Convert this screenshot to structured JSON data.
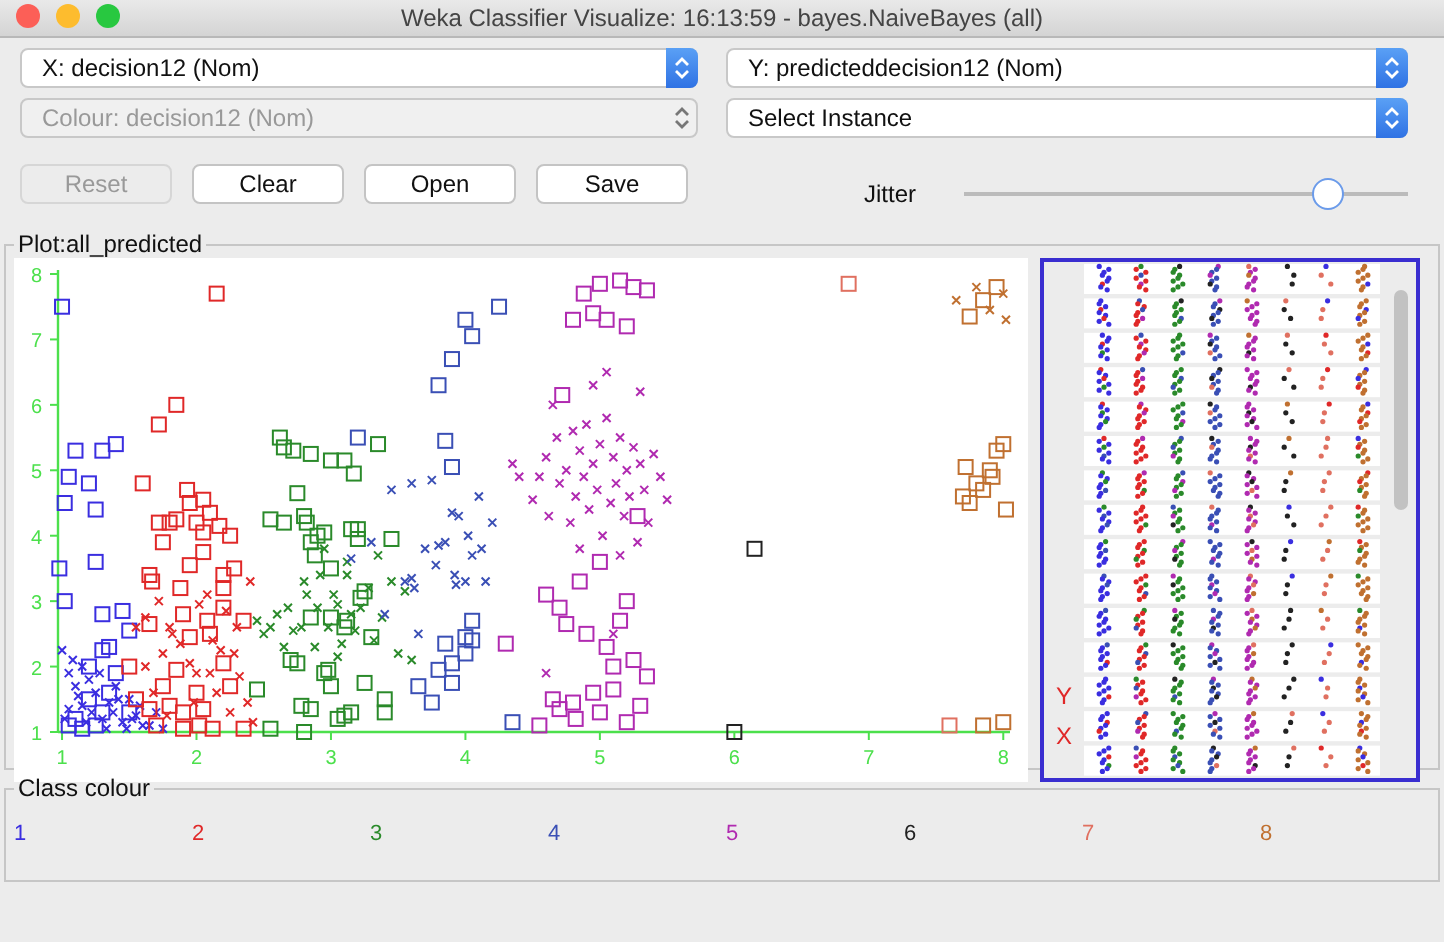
{
  "window": {
    "title": "Weka Classifier Visualize: 16:13:59 - bayes.NaiveBayes (all)"
  },
  "selectors": [
    {
      "label": "X: decision12 (Nom)",
      "disabled": false
    },
    {
      "label": "Y: predicteddecision12 (Nom)",
      "disabled": false
    },
    {
      "label": "Colour: decision12 (Nom)",
      "disabled": true
    },
    {
      "label": "Select Instance",
      "disabled": false
    }
  ],
  "buttons": [
    {
      "label": "Reset",
      "disabled": true
    },
    {
      "label": "Clear",
      "disabled": false
    },
    {
      "label": "Open",
      "disabled": false
    },
    {
      "label": "Save",
      "disabled": false
    }
  ],
  "jitter": {
    "label": "Jitter",
    "level": 0.82
  },
  "plot": {
    "title": "Plot:all_predicted",
    "chart_data": {
      "type": "scatter",
      "xlim": [
        0.97,
        8.05
      ],
      "ylim": [
        1,
        8
      ],
      "xticks": [
        1,
        2,
        3,
        4,
        5,
        6,
        7,
        8
      ],
      "yticks": [
        1,
        2,
        3,
        4,
        5,
        6,
        7,
        8
      ],
      "series": [
        {
          "color": "#3a2ee0",
          "marker": "square",
          "x": [
            1,
            1.1,
            1.05,
            1.2,
            1.3,
            1.4,
            1.02,
            1.25,
            1.25,
            0.98,
            1.02,
            1.45,
            1.3,
            1.35,
            1.3,
            1.5,
            1.2,
            1.4,
            1.1,
            1.2,
            1.05,
            1.3,
            1.15,
            1.35,
            1.25,
            1.5
          ],
          "values": [
            7.5,
            5.3,
            4.9,
            4.8,
            5.3,
            5.4,
            4.5,
            4.4,
            3.6,
            3.5,
            3,
            2.85,
            2.8,
            2.3,
            2.25,
            2.55,
            2,
            1.9,
            1.2,
            1.5,
            1.1,
            1.3,
            1.05,
            1.6,
            1.1,
            1.3
          ]
        },
        {
          "color": "#3a2ee0",
          "marker": "cross",
          "x": [
            1,
            1.05,
            1.1,
            1.15,
            1.2,
            1.25,
            1.3,
            1.35,
            1.4,
            1.45,
            1.5,
            1.55,
            1.6,
            1.05,
            1.12,
            1.18,
            1.22,
            1.28,
            1.33,
            1.38,
            1.42,
            1.48,
            1.52,
            1.58,
            1.65,
            1.7,
            1.75,
            1.02,
            1.08,
            1.15
          ],
          "values": [
            2.25,
            1.9,
            1.7,
            1.4,
            1.8,
            1.6,
            1.2,
            1.45,
            1.7,
            1.15,
            1.5,
            1.25,
            1.1,
            1.35,
            1.55,
            1.15,
            1.3,
            1.9,
            1.05,
            1.3,
            1.5,
            1.05,
            1.2,
            1.4,
            1.1,
            1.3,
            1.05,
            1.2,
            2.1,
            2
          ]
        },
        {
          "color": "#e02828",
          "marker": "square",
          "x": [
            2.15,
            1.85,
            1.72,
            1.6,
            1.72,
            1.8,
            1.85,
            1.95,
            1.93,
            2.05,
            2.1,
            2.0,
            2.05,
            2.17,
            2.25,
            1.75,
            1.95,
            2.05,
            2.2,
            1.65,
            1.67,
            1.88,
            2.28,
            2.2,
            1.9,
            2.08,
            2.2,
            1.65,
            2.35,
            1.5,
            1.95,
            2.1,
            2.2,
            2.25,
            1.75,
            1.85,
            2,
            1.55,
            1.65,
            1.8,
            1.9,
            2.05,
            1.7,
            1.9,
            2.02,
            2.12,
            2.35
          ],
          "values": [
            7.7,
            6,
            5.7,
            4.8,
            4.2,
            4.2,
            4.25,
            4.5,
            4.7,
            4.55,
            4.35,
            4.2,
            4.05,
            4.15,
            4.0,
            3.9,
            3.55,
            3.75,
            3.4,
            3.4,
            3.3,
            3.2,
            3.5,
            3.2,
            2.8,
            2.7,
            2.9,
            2.65,
            2.7,
            2,
            2.45,
            2.5,
            2.05,
            1.7,
            1.7,
            1.95,
            1.6,
            1.5,
            1.35,
            1.4,
            1.3,
            1.35,
            1.1,
            1.05,
            1.1,
            1.05,
            1.05
          ]
        },
        {
          "color": "#e02828",
          "marker": "cross",
          "x": [
            1.55,
            1.62,
            1.75,
            1.8,
            1.88,
            1.95,
            2.02,
            2.08,
            2.12,
            2.18,
            2.22,
            2.28,
            2.32,
            2.38,
            2.4,
            1.72,
            1.82,
            2.0,
            2.15,
            2.25,
            1.62,
            1.68,
            1.78,
            1.98,
            2.1,
            2.42,
            2.3
          ],
          "values": [
            2.6,
            2.75,
            2.2,
            2.6,
            2.35,
            2.05,
            2.95,
            3.1,
            2.4,
            2.25,
            2.85,
            2.2,
            1.85,
            1.45,
            3.3,
            3.0,
            2.5,
            1.9,
            1.6,
            1.3,
            2.0,
            1.6,
            1.25,
            1.45,
            1.9,
            1.15,
            2.6
          ]
        },
        {
          "color": "#2a8a2a",
          "marker": "square",
          "x": [
            2.62,
            2.65,
            2.72,
            2.85,
            3,
            3.1,
            3.17,
            3.35,
            2.75,
            2.55,
            2.65,
            2.8,
            2.82,
            2.9,
            2.95,
            3.15,
            3.2,
            3.2,
            3.45,
            2.85,
            2.88,
            3.0,
            3.25,
            3.22,
            3.0,
            3.1,
            3.12,
            2.85,
            2.98,
            2.95,
            3.3,
            2.7,
            2.75,
            2.45,
            2.78,
            2.85,
            3.0,
            3.25,
            3.4,
            3.4,
            3.1,
            3.05,
            3.15,
            2.55,
            2.8
          ],
          "values": [
            5.5,
            5.35,
            5.3,
            5.25,
            5.15,
            5.15,
            4.95,
            5.4,
            4.65,
            4.25,
            4.2,
            4.3,
            4.2,
            4.0,
            4.05,
            4.1,
            4.1,
            3.95,
            3.95,
            3.9,
            3.7,
            3.5,
            3.15,
            3.05,
            2.75,
            2.6,
            2.7,
            2.75,
            1.95,
            1.9,
            2.45,
            2.1,
            2.05,
            1.65,
            1.4,
            1.35,
            1.7,
            1.75,
            1.5,
            1.3,
            1.25,
            1.2,
            1.3,
            1.05,
            1.0
          ]
        },
        {
          "color": "#2a8a2a",
          "marker": "cross",
          "x": [
            2.45,
            2.55,
            2.6,
            2.68,
            2.72,
            2.8,
            2.82,
            2.9,
            2.92,
            2.98,
            3.02,
            3.05,
            3.08,
            3.12,
            3.15,
            3.18,
            3.22,
            3.28,
            3.32,
            3.38,
            3.45,
            3.5,
            3.55,
            3.6,
            2.88,
            2.78,
            2.65,
            3.12,
            3.35,
            2.95,
            3.05,
            2.5
          ],
          "values": [
            2.7,
            2.6,
            2.8,
            2.9,
            2.55,
            3.3,
            3.1,
            2.9,
            3.4,
            2.6,
            3.1,
            2.95,
            2.35,
            3.6,
            2.8,
            2.55,
            2.9,
            3.2,
            2.4,
            2.75,
            3.3,
            2.2,
            3.15,
            2.1,
            2.3,
            2.6,
            2.3,
            3.4,
            3.7,
            3.8,
            2.15,
            2.5
          ]
        },
        {
          "color": "#3a4fb5",
          "marker": "square",
          "x": [
            4.05,
            3.9,
            3.8,
            3.85,
            3.9,
            4.0,
            4.05,
            4.0,
            3.85,
            3.8,
            3.9,
            3.9,
            3.65,
            3.75,
            4.35,
            4.25,
            4.0,
            3.2,
            4.05
          ],
          "values": [
            7.05,
            6.7,
            6.3,
            5.45,
            5.05,
            2.45,
            2.4,
            2.2,
            2.35,
            1.95,
            2.05,
            1.75,
            1.7,
            1.45,
            1.15,
            7.5,
            7.3,
            5.5,
            2.7
          ]
        },
        {
          "color": "#3a4fb5",
          "marker": "cross",
          "x": [
            3.45,
            3.6,
            3.75,
            3.8,
            3.85,
            3.9,
            3.95,
            3.7,
            3.6,
            3.62,
            3.78,
            3.92,
            3.93,
            4.05,
            4.02,
            4.0,
            4.15,
            4.12,
            3.4,
            3.3,
            3.15,
            3.65,
            3.55,
            4.1,
            4.2
          ],
          "values": [
            4.7,
            4.8,
            4.85,
            3.85,
            3.9,
            4.35,
            4.3,
            3.8,
            3.35,
            3.2,
            3.55,
            3.4,
            3.25,
            3.7,
            4.0,
            3.3,
            3.3,
            3.8,
            2.8,
            3.9,
            3.65,
            2.5,
            3.3,
            4.6,
            4.2
          ]
        },
        {
          "color": "#b02ab0",
          "marker": "square",
          "x": [
            4.3,
            5.0,
            4.88,
            5.15,
            5.25,
            4.95,
            5.05,
            5.2,
            5.35,
            4.8,
            4.6,
            4.7,
            4.75,
            4.85,
            4.9,
            5.0,
            5.05,
            5.1,
            5.15,
            5.2,
            5.25,
            4.65,
            4.7,
            4.8,
            4.82,
            4.95,
            5.0,
            5.1,
            5.2,
            5.3,
            4.55,
            5.35,
            4.72,
            5.28
          ],
          "values": [
            2.35,
            7.85,
            7.7,
            7.9,
            7.8,
            7.4,
            7.3,
            7.2,
            7.75,
            7.3,
            3.1,
            2.9,
            2.65,
            3.3,
            2.5,
            3.6,
            2.3,
            2.0,
            2.7,
            3.0,
            2.1,
            1.5,
            1.35,
            1.45,
            1.2,
            1.6,
            1.3,
            1.65,
            1.15,
            1.4,
            1.1,
            1.85,
            6.15,
            4.3
          ]
        },
        {
          "color": "#b02ab0",
          "marker": "cross",
          "x": [
            4.5,
            4.55,
            4.6,
            4.62,
            4.68,
            4.7,
            4.75,
            4.78,
            4.8,
            4.82,
            4.85,
            4.88,
            4.9,
            4.92,
            4.95,
            4.98,
            5.0,
            5.02,
            5.05,
            5.08,
            5.1,
            5.12,
            5.15,
            5.18,
            5.2,
            5.22,
            5.25,
            5.28,
            5.3,
            5.33,
            5.36,
            5.4,
            5.45,
            5.5,
            4.4,
            4.35,
            4.95,
            5.05,
            4.85,
            5.15,
            4.65,
            5.3,
            4.6,
            5.1
          ],
          "values": [
            4.55,
            4.9,
            5.2,
            4.3,
            5.5,
            4.8,
            5.0,
            4.2,
            5.6,
            4.6,
            5.3,
            4.9,
            5.7,
            4.4,
            5.1,
            4.7,
            5.4,
            4.0,
            5.8,
            4.5,
            5.2,
            4.8,
            5.5,
            4.3,
            5.0,
            4.6,
            5.35,
            3.9,
            5.1,
            4.7,
            4.2,
            5.25,
            4.9,
            4.55,
            4.9,
            5.1,
            6.3,
            6.5,
            3.8,
            3.7,
            6.0,
            6.2,
            1.9,
            2.5
          ]
        },
        {
          "color": "#222222",
          "marker": "square",
          "x": [
            6.15,
            6.0
          ],
          "values": [
            3.8,
            1.0
          ]
        },
        {
          "color": "#e07060",
          "marker": "square",
          "x": [
            6.85,
            7.6
          ],
          "values": [
            7.85,
            1.1
          ]
        },
        {
          "color": "#c07030",
          "marker": "square",
          "x": [
            7.95,
            7.85,
            7.75,
            7.7,
            7.75,
            7.8,
            7.85,
            7.9,
            7.95,
            8.0,
            7.92,
            8.02,
            7.72,
            7.85,
            8.0
          ],
          "values": [
            7.8,
            7.6,
            7.35,
            4.6,
            4.5,
            4.8,
            4.7,
            5.0,
            5.3,
            5.4,
            4.9,
            4.4,
            5.05,
            1.1,
            1.15
          ]
        },
        {
          "color": "#c07030",
          "marker": "cross",
          "x": [
            7.65,
            7.8,
            7.9,
            8.0,
            8.02
          ],
          "values": [
            7.6,
            7.8,
            7.45,
            7.7,
            7.3
          ]
        }
      ]
    }
  },
  "matrix": {
    "labels": [
      "Y",
      "X"
    ]
  },
  "class_colour": {
    "title": "Class colour",
    "classes": [
      {
        "label": "1",
        "color": "#3a2ee0"
      },
      {
        "label": "2",
        "color": "#e02828"
      },
      {
        "label": "3",
        "color": "#2a8a2a"
      },
      {
        "label": "4",
        "color": "#3a4fb5"
      },
      {
        "label": "5",
        "color": "#b02ab0"
      },
      {
        "label": "6",
        "color": "#222222"
      },
      {
        "label": "7",
        "color": "#e07060"
      },
      {
        "label": "8",
        "color": "#c07030"
      }
    ]
  }
}
